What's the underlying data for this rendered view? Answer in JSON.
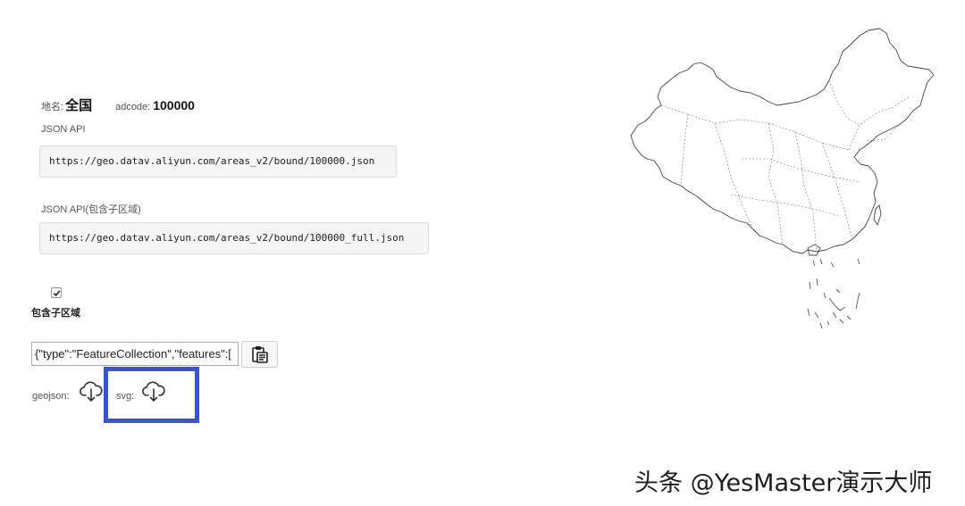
{
  "region": {
    "name_label": "地名:",
    "name": "全国",
    "adcode_label": "adcode:",
    "adcode": "100000"
  },
  "api": {
    "json_title": "JSON API",
    "json_url": "https://geo.datav.aliyun.com/areas_v2/bound/100000.json",
    "full_title": "JSON API(包含子区域)",
    "full_url": "https://geo.datav.aliyun.com/areas_v2/bound/100000_full.json"
  },
  "options": {
    "include_sub_label": "包含子区域",
    "include_sub_checked": true
  },
  "output": {
    "json_value": "{\"type\":\"FeatureCollection\",\"features\":["
  },
  "downloads": {
    "geojson_label": "geojson:",
    "svg_label": "svg:"
  },
  "icons": {
    "copy": "clipboard-icon",
    "download": "cloud-download-icon"
  },
  "colors": {
    "highlight": "#3a55c8"
  },
  "watermark": "头条 @YesMaster演示大师"
}
